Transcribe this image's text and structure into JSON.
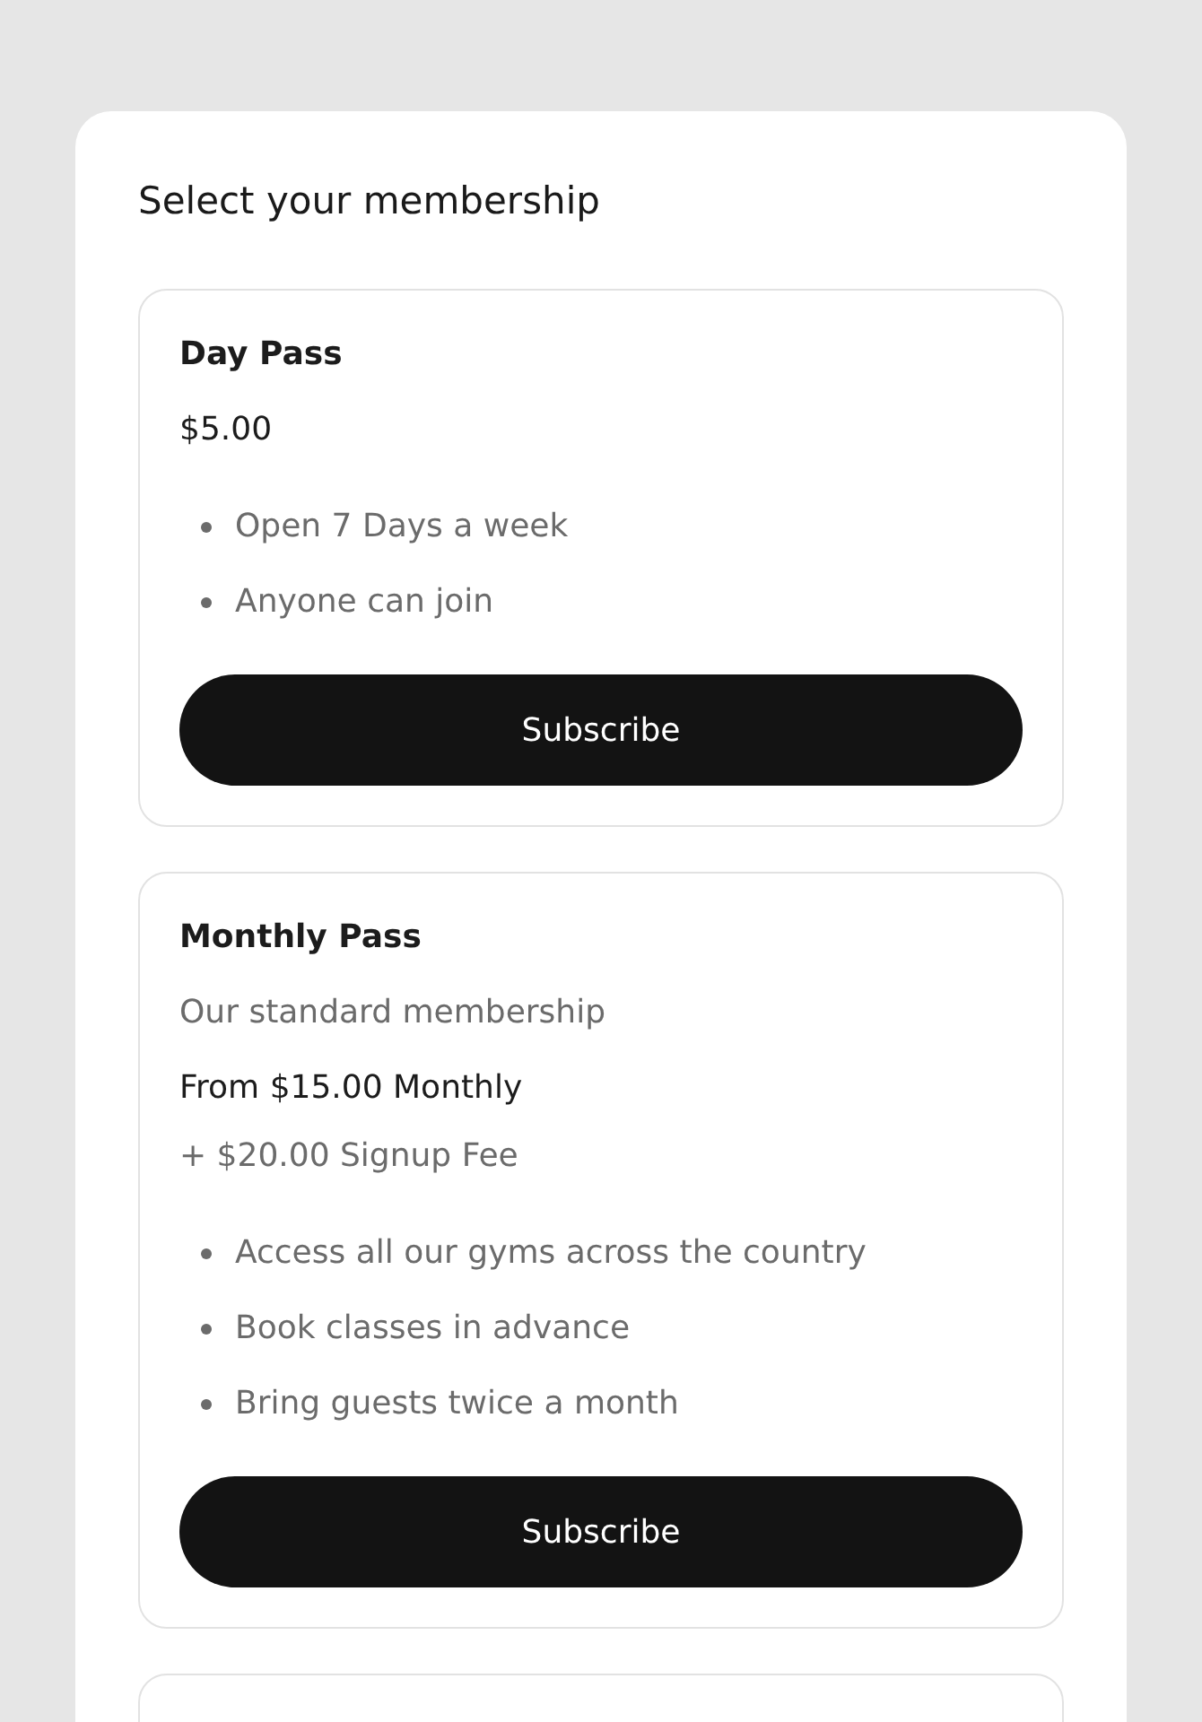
{
  "heading": "Select your membership",
  "plans": [
    {
      "name": "Day Pass",
      "price": "$5.00",
      "features": [
        "Open 7 Days a week",
        "Anyone can join"
      ],
      "button": "Subscribe"
    },
    {
      "name": "Monthly Pass",
      "description": "Our standard membership",
      "price": "From $15.00 Monthly",
      "fee": "+ $20.00 Signup Fee",
      "features": [
        "Access all our gyms across the country",
        "Book classes in advance",
        "Bring guests twice a month"
      ],
      "button": "Subscribe"
    }
  ]
}
